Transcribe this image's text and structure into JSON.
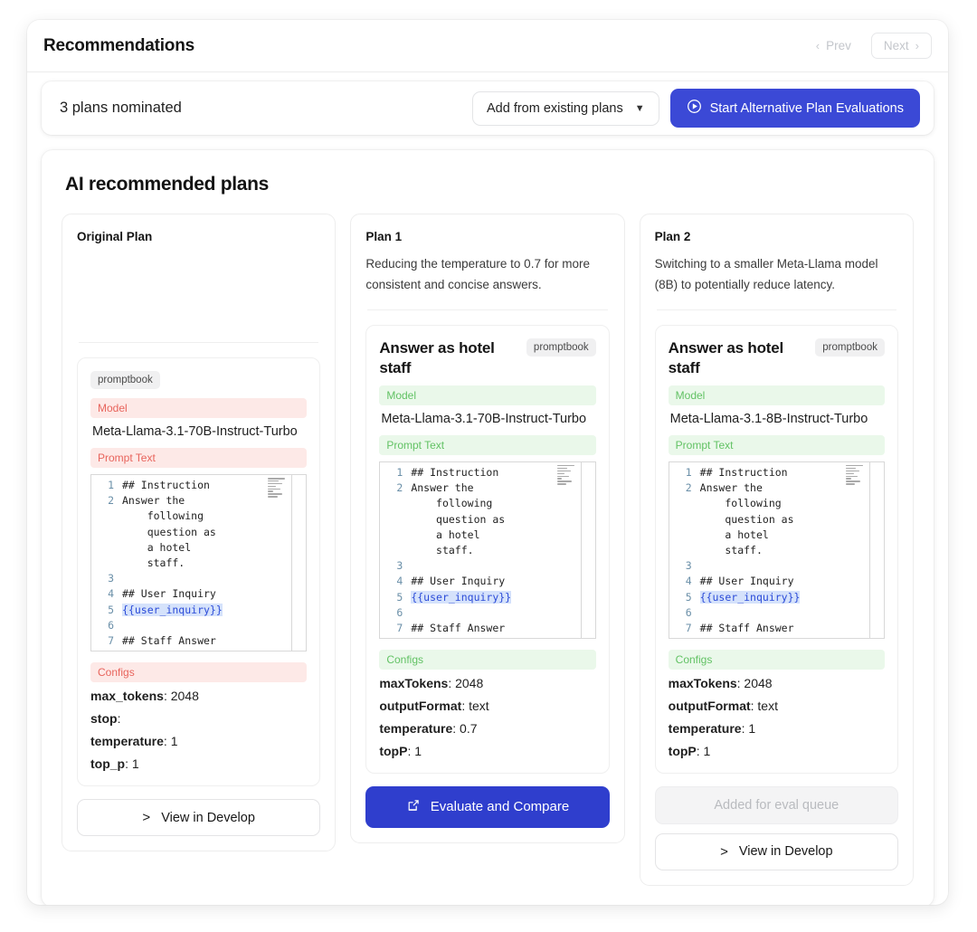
{
  "header": {
    "title": "Recommendations",
    "prev_label": "Prev",
    "next_label": "Next"
  },
  "nominated_bar": {
    "count_text": "3 plans nominated",
    "add_existing_label": "Add from existing plans",
    "add_existing_caret": "chevron-down-icon",
    "start_eval_label": "Start Alternative Plan Evaluations",
    "start_eval_icon": "play-circle-icon",
    "start_eval_color": "#3b49d6"
  },
  "recommendations": {
    "section_title": "AI recommended plans",
    "promptbook_chip": "promptbook",
    "labels": {
      "model": "Model",
      "prompt_text": "Prompt Text",
      "configs": "Configs"
    },
    "accent_pink_bg": "#fde9e7",
    "accent_pink_fg": "#e8645c",
    "accent_green_bg": "#eaf8ea",
    "accent_green_fg": "#62c264",
    "code": {
      "line_numbers": [
        "1",
        "2",
        "",
        "",
        "",
        "",
        "3",
        "4",
        "5",
        "6",
        "7"
      ],
      "lines": [
        "## Instruction",
        "Answer the",
        "    following",
        "    question as",
        "    a hotel",
        "    staff.",
        "",
        "## User Inquiry",
        "{{user_inquiry}}",
        "",
        "## Staff Answer"
      ],
      "variable_token": "{{user_inquiry}}"
    },
    "plans": [
      {
        "name": "Original Plan",
        "description": "",
        "prompt_title": "",
        "model": "Meta-Llama-3.1-70B-Instruct-Turbo",
        "label_style": "pink",
        "configs": [
          {
            "key": "max_tokens",
            "value": "2048"
          },
          {
            "key": "stop",
            "value": ""
          },
          {
            "key": "temperature",
            "value": "1"
          },
          {
            "key": "top_p",
            "value": "1"
          }
        ],
        "actions": [
          {
            "type": "ghost",
            "label": "View in Develop",
            "icon": "chevron-right-icon"
          }
        ]
      },
      {
        "name": "Plan 1",
        "description": "Reducing the temperature to 0.7 for more consistent and concise answers.",
        "prompt_title": "Answer as hotel staff",
        "model": "Meta-Llama-3.1-70B-Instruct-Turbo",
        "label_style": "green",
        "configs": [
          {
            "key": "maxTokens",
            "value": "2048"
          },
          {
            "key": "outputFormat",
            "value": "text"
          },
          {
            "key": "temperature",
            "value": "0.7"
          },
          {
            "key": "topP",
            "value": "1"
          }
        ],
        "actions": [
          {
            "type": "primary",
            "label": "Evaluate and Compare",
            "icon": "launch-icon"
          }
        ]
      },
      {
        "name": "Plan 2",
        "description": "Switching to a smaller Meta-Llama model (8B) to potentially reduce latency.",
        "prompt_title": "Answer as hotel staff",
        "model": "Meta-Llama-3.1-8B-Instruct-Turbo",
        "label_style": "green",
        "configs": [
          {
            "key": "maxTokens",
            "value": "2048"
          },
          {
            "key": "outputFormat",
            "value": "text"
          },
          {
            "key": "temperature",
            "value": "1"
          },
          {
            "key": "topP",
            "value": "1"
          }
        ],
        "actions": [
          {
            "type": "disabled",
            "label": "Added for eval queue",
            "icon": ""
          },
          {
            "type": "ghost",
            "label": "View in Develop",
            "icon": "chevron-right-icon"
          }
        ]
      }
    ]
  }
}
